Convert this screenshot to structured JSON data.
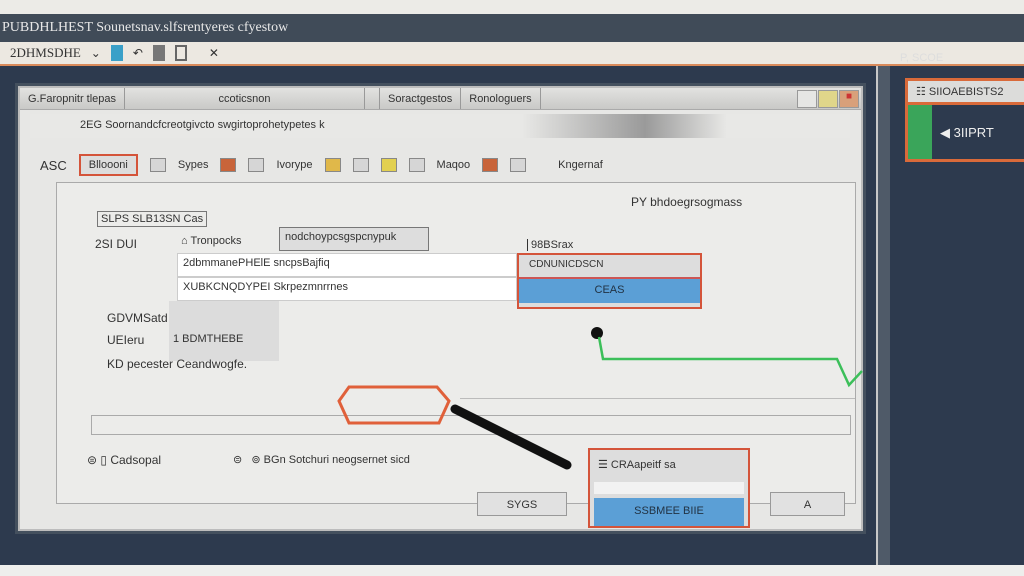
{
  "window": {
    "title": "PUBDHLHEST Sounetsnav.slfsrentyeres cfyestow"
  },
  "toolbar": {
    "label": "2DHMSDHE",
    "items": [
      "bookmark-icon",
      "undo-icon",
      "save-icon",
      "page-icon",
      "close-icon"
    ]
  },
  "dialog": {
    "tabs": [
      "G.Faropnitr tlepas",
      "ccoticsnon"
    ],
    "tabs_right": [
      "Soractgestos",
      "Ronologuers"
    ],
    "subtitle": "2EG Soornandcfcreotgivcto swgirtoprohetypetes k",
    "tools_label": "ASC",
    "tools": [
      "Blloooni",
      "Sypes",
      "Ivorype",
      "Maqoo",
      "Kngernaf"
    ],
    "group_caption": "PY bhdoegrsogmass",
    "section_label": "SLPS SLB13SN Cas",
    "row_label": "2SI DUI",
    "search_prefix": "Tronpocks",
    "search_value": "nodchoypcsgspcnypuk",
    "list": [
      "2dbmmanePHElE sncpsBajfiq",
      "XUBKCNQDYPEI Skrpezmnrrnes"
    ],
    "right_label": "98BSrax",
    "dropdown_value": "CDNUNICDSCN",
    "dropdown_selected": "CEAS",
    "form_label1": "GDVMSatd",
    "form_label2": "UEIeru",
    "form_value": "1  BDMTHEBE",
    "form_label3": "KD pecester  Ceandwogfe.",
    "check1": "Cadsopal",
    "check2": "BGn Sotchuri neogsernet sicd",
    "popup_label": "CRAapeitf sa",
    "cancel": "SYGS",
    "primary": "SSBMEE BIIE",
    "extra": "A"
  },
  "side_panel": {
    "caption": "P, SCOE",
    "header": "SIIOAEBISTS2",
    "item": "3IIPRT"
  }
}
